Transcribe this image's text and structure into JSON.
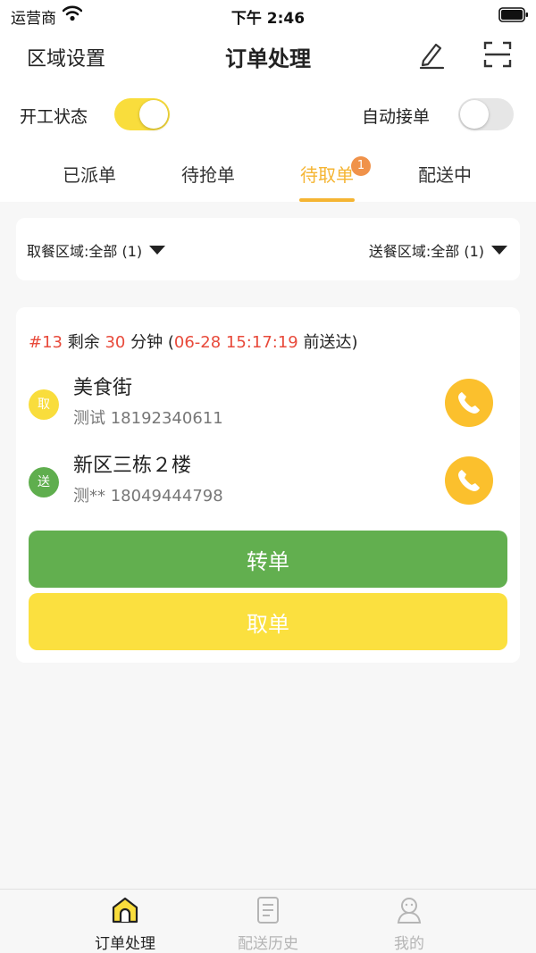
{
  "status_bar": {
    "carrier": "运营商",
    "time": "下午 2:46"
  },
  "nav": {
    "region_button": "区域设置",
    "title": "订单处理",
    "edit_icon": "edit-icon",
    "scan_icon": "scan-icon"
  },
  "work_status": {
    "label": "开工状态",
    "on": true
  },
  "auto_accept": {
    "label": "自动接单",
    "on": false
  },
  "tabs": [
    {
      "label": "已派单"
    },
    {
      "label": "待抢单"
    },
    {
      "label": "待取单",
      "badge": "1",
      "active": true
    },
    {
      "label": "配送中"
    }
  ],
  "filters": {
    "pickup": "取餐区域:全部 (1)",
    "delivery": "送餐区域:全部 (1)"
  },
  "order": {
    "number": "#13",
    "remain_prefix": "剩余",
    "remain_minutes": "30",
    "remain_unit": "分钟",
    "open_paren": "(",
    "deadline": "06-28 15:17:19",
    "deadline_suffix": "前送达)",
    "pickup": {
      "badge": "取",
      "name": "美食街",
      "contact": "测试 18192340611"
    },
    "delivery": {
      "badge": "送",
      "name": "新区三栋２楼",
      "contact": "测** 18049444798"
    },
    "transfer_button": "转单",
    "cancel_button": "取单"
  },
  "tabbar": [
    {
      "label": "订单处理",
      "icon": "home-icon",
      "active": true
    },
    {
      "label": "配送历史",
      "icon": "document-icon"
    },
    {
      "label": "我的",
      "icon": "user-icon"
    }
  ],
  "colors": {
    "accent_yellow": "#f9dd3c",
    "tab_active": "#f5b533",
    "red": "#e84a3b",
    "green": "#62af4f",
    "phone_orange": "#fbc02d",
    "badge_orange": "#f0924a"
  }
}
